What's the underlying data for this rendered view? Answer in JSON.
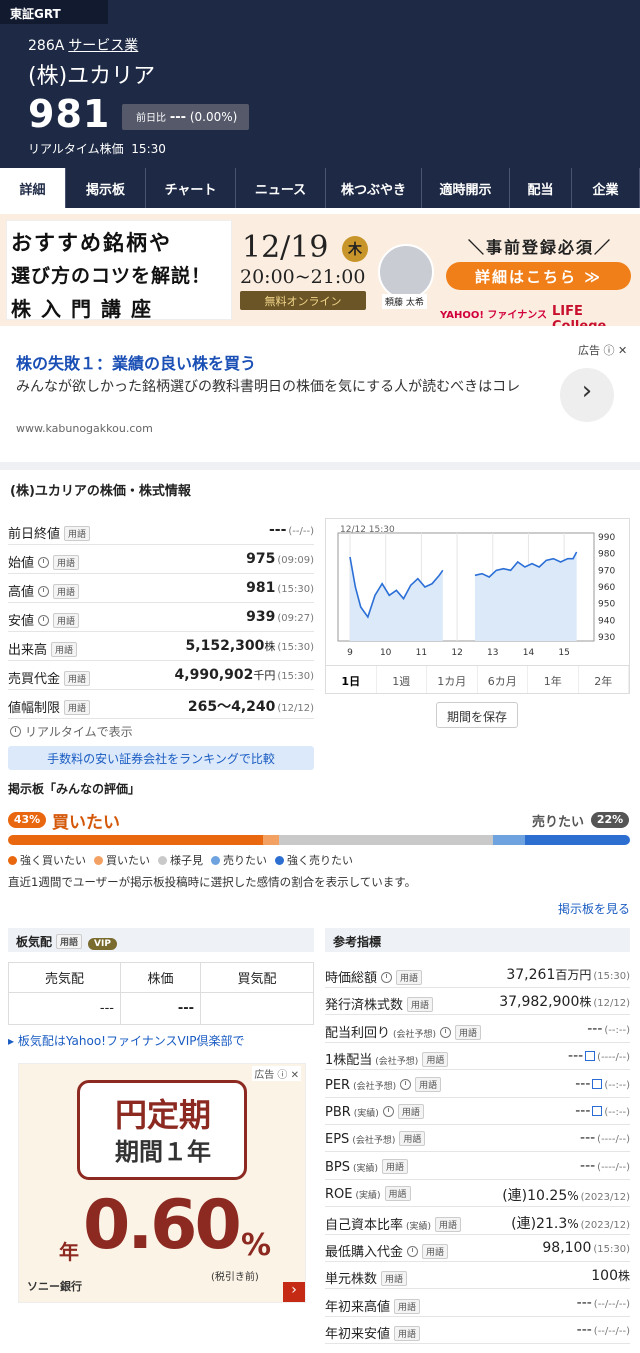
{
  "header": {
    "market": "東証GRT",
    "code": "286A",
    "sector": "サービス業",
    "name": "(株)ユカリア",
    "price": "981",
    "change_label": "前日比",
    "change_value": "---",
    "change_pct": "(0.00%)",
    "realtime": "リアルタイム株価",
    "time": "15:30"
  },
  "tabs": [
    "詳細",
    "掲示板",
    "チャート",
    "ニュース",
    "株つぶやき",
    "適時開示",
    "配当",
    "企業"
  ],
  "banner": {
    "line1": "おすすめ銘柄や",
    "line2": "選び方のコツを解説！",
    "line3": "株入門講座",
    "date": "12/19",
    "weekday": "木",
    "time": "20:00~21:00",
    "online": "無料オンライン",
    "register": "＼事前登録必須／",
    "cta": "詳細はこちら ≫",
    "speaker": "頼藤 太希",
    "logo1": "YAHOO! ファイナンス",
    "logo2": "LIFE College"
  },
  "ad1": {
    "title": "株の失敗１：業績の良い株を買う",
    "text": "みんなが欲しかった銘柄選びの教科書明日の株価を気にする人が読むべきはコレ",
    "url": "www.kabunogakkou.com",
    "ad_label": "広告"
  },
  "section_title": "(株)ユカリアの株価・株式情報",
  "quote": [
    {
      "label": "前日終値",
      "clock": false,
      "value": "---",
      "unit": "",
      "time": "(--/--)"
    },
    {
      "label": "始値",
      "clock": true,
      "value": "975",
      "unit": "",
      "time": "(09:09)"
    },
    {
      "label": "高値",
      "clock": true,
      "value": "981",
      "unit": "",
      "time": "(15:30)"
    },
    {
      "label": "安値",
      "clock": true,
      "value": "939",
      "unit": "",
      "time": "(09:27)"
    },
    {
      "label": "出来高",
      "clock": false,
      "value": "5,152,300",
      "unit": "株",
      "time": "(15:30)"
    },
    {
      "label": "売買代金",
      "clock": false,
      "value": "4,990,902",
      "unit": "千円",
      "time": "(15:30)"
    },
    {
      "label": "値幅制限",
      "clock": false,
      "value": "265～4,240",
      "unit": "",
      "time": "(12/12)"
    }
  ],
  "term": "用語",
  "realtime_note": "リアルタイムで表示",
  "ranking_button": "手数料の安い証券会社をランキングで比較",
  "chart_data": {
    "type": "line",
    "title": "12/12 15:30",
    "x_ticks": [
      "9",
      "10",
      "11",
      "12",
      "13",
      "14",
      "15"
    ],
    "y_ticks": [
      990,
      980,
      970,
      960,
      950,
      940,
      930
    ],
    "ylim": [
      930,
      990
    ],
    "series": [
      {
        "name": "",
        "values": [
          [
            0,
            978
          ],
          [
            0.15,
            960
          ],
          [
            0.3,
            948
          ],
          [
            0.5,
            942
          ],
          [
            0.7,
            955
          ],
          [
            0.9,
            962
          ],
          [
            1.1,
            955
          ],
          [
            1.3,
            958
          ],
          [
            1.5,
            953
          ],
          [
            1.7,
            961
          ],
          [
            1.9,
            965
          ],
          [
            2.1,
            960
          ],
          [
            2.3,
            962
          ],
          [
            2.5,
            967
          ],
          [
            2.6,
            970
          ],
          [
            3.5,
            967
          ],
          [
            3.7,
            968
          ],
          [
            3.9,
            966
          ],
          [
            4.1,
            970
          ],
          [
            4.3,
            971
          ],
          [
            4.5,
            970
          ],
          [
            4.7,
            975
          ],
          [
            4.9,
            972
          ],
          [
            5.1,
            974
          ],
          [
            5.3,
            972
          ],
          [
            5.5,
            976
          ],
          [
            5.7,
            977
          ],
          [
            5.9,
            975
          ],
          [
            6.1,
            977
          ],
          [
            6.25,
            977
          ],
          [
            6.35,
            981
          ]
        ]
      }
    ],
    "periods": [
      "1日",
      "1週",
      "1カ月",
      "6カ月",
      "1年",
      "2年"
    ]
  },
  "save_period": "期間を保存",
  "board": {
    "title": "掲示板「みんなの評価」",
    "buy_pct": "43%",
    "buy_label": "買いたい",
    "sell_label": "売りたい",
    "sell_pct": "22%",
    "segments": [
      {
        "label": "強く買いたい",
        "color": "#e8670f",
        "value": 41
      },
      {
        "label": "買いたい",
        "color": "#f3a063",
        "value": 2.6
      },
      {
        "label": "様子見",
        "color": "#c9c9c9",
        "value": 34.4
      },
      {
        "label": "売りたい",
        "color": "#6ea3e0",
        "value": 5.2
      },
      {
        "label": "強く売りたい",
        "color": "#2d6fd0",
        "value": 16.8
      }
    ],
    "note": "直近1週間でユーザーが掲示板投稿時に選択した感情の割合を表示しています。",
    "link": "掲示板を見る"
  },
  "orderbook": {
    "title": "板気配",
    "vip": "VIP",
    "cols": [
      "売気配",
      "株価",
      "買気配"
    ],
    "cells": [
      "---",
      "---",
      ""
    ],
    "link": "板気配はYahoo!ファイナンスVIP倶楽部で"
  },
  "ad2": {
    "ad_label": "広告",
    "line1": "円定期",
    "line2": "期間１年",
    "rate": "0.60",
    "pct": "%",
    "prefix": "年",
    "note": "(税引き前)",
    "bank": "ソニー銀行"
  },
  "indicators": {
    "title": "参考指標",
    "rows": [
      {
        "label": "時価総額",
        "sub": "",
        "clock": true,
        "link": false,
        "value": "37,261",
        "unit": "百万円",
        "time": "(15:30)"
      },
      {
        "label": "発行済株式数",
        "sub": "",
        "clock": false,
        "link": false,
        "value": "37,982,900",
        "unit": "株",
        "time": "(12/12)"
      },
      {
        "label": "配当利回り",
        "sub": "(会社予想)",
        "clock": true,
        "link": false,
        "value": "---",
        "unit": "",
        "time": "(--:--)"
      },
      {
        "label": "1株配当",
        "sub": "(会社予想)",
        "clock": false,
        "link": true,
        "value": "---",
        "unit": "",
        "time": "(----/--)"
      },
      {
        "label": "PER",
        "sub": "(会社予想)",
        "clock": true,
        "link": true,
        "value": "---",
        "unit": "",
        "time": "(--:--)"
      },
      {
        "label": "PBR",
        "sub": "(実績)",
        "clock": true,
        "link": true,
        "value": "---",
        "unit": "",
        "time": "(--:--)"
      },
      {
        "label": "EPS",
        "sub": "(会社予想)",
        "clock": false,
        "link": false,
        "value": "---",
        "unit": "",
        "time": "(----/--)"
      },
      {
        "label": "BPS",
        "sub": "(実績)",
        "clock": false,
        "link": false,
        "value": "---",
        "unit": "",
        "time": "(----/--)"
      },
      {
        "label": "ROE",
        "sub": "(実績)",
        "clock": false,
        "link": false,
        "value": "(連)10.25",
        "unit": "%",
        "time": "(2023/12)"
      },
      {
        "label": "自己資本比率",
        "sub": "(実績)",
        "clock": false,
        "link": false,
        "value": "(連)21.3",
        "unit": "%",
        "time": "(2023/12)"
      },
      {
        "label": "最低購入代金",
        "sub": "",
        "clock": true,
        "link": false,
        "value": "98,100",
        "unit": "",
        "time": "(15:30)"
      },
      {
        "label": "単元株数",
        "sub": "",
        "clock": false,
        "link": false,
        "value": "100",
        "unit": "株",
        "time": ""
      },
      {
        "label": "年初来高値",
        "sub": "",
        "clock": false,
        "link": false,
        "value": "---",
        "unit": "",
        "time": "(--/--/--)"
      },
      {
        "label": "年初来安値",
        "sub": "",
        "clock": false,
        "link": false,
        "value": "---",
        "unit": "",
        "time": "(--/--/--)"
      }
    ]
  }
}
